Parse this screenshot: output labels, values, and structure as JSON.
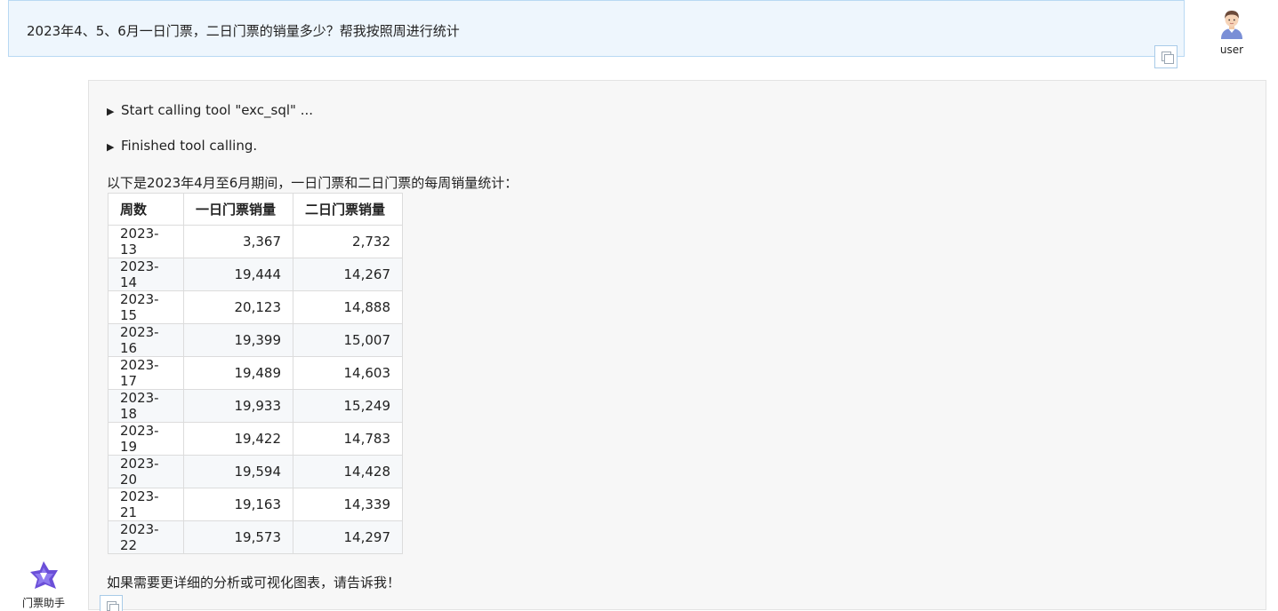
{
  "user_message": {
    "text": "2023年4、5、6月一日门票，二日门票的销量多少？帮我按照周进行统计",
    "avatar_name": "user",
    "copy_icon": "copy-icon"
  },
  "assistant": {
    "name": "门票助手",
    "tool_calls": [
      {
        "label": "Start calling tool \"exc_sql\" ..."
      },
      {
        "label": "Finished tool calling."
      }
    ],
    "intro": "以下是2023年4月至6月期间，一日门票和二日门票的每周销量统计：",
    "table": {
      "headers": [
        "周数",
        "一日门票销量",
        "二日门票销量"
      ],
      "rows": [
        [
          "2023-13",
          "3,367",
          "2,732"
        ],
        [
          "2023-14",
          "19,444",
          "14,267"
        ],
        [
          "2023-15",
          "20,123",
          "14,888"
        ],
        [
          "2023-16",
          "19,399",
          "15,007"
        ],
        [
          "2023-17",
          "19,489",
          "14,603"
        ],
        [
          "2023-18",
          "19,933",
          "15,249"
        ],
        [
          "2023-19",
          "19,422",
          "14,783"
        ],
        [
          "2023-20",
          "19,594",
          "14,428"
        ],
        [
          "2023-21",
          "19,163",
          "14,339"
        ],
        [
          "2023-22",
          "19,573",
          "14,297"
        ]
      ]
    },
    "outro": "如果需要更详细的分析或可视化图表，请告诉我！"
  },
  "colors": {
    "user_bubble_bg": "#eef6fd",
    "user_bubble_border": "#b9d9f3",
    "assistant_bg": "#f7f7f7",
    "brand_purple": "#6b4fd8"
  }
}
